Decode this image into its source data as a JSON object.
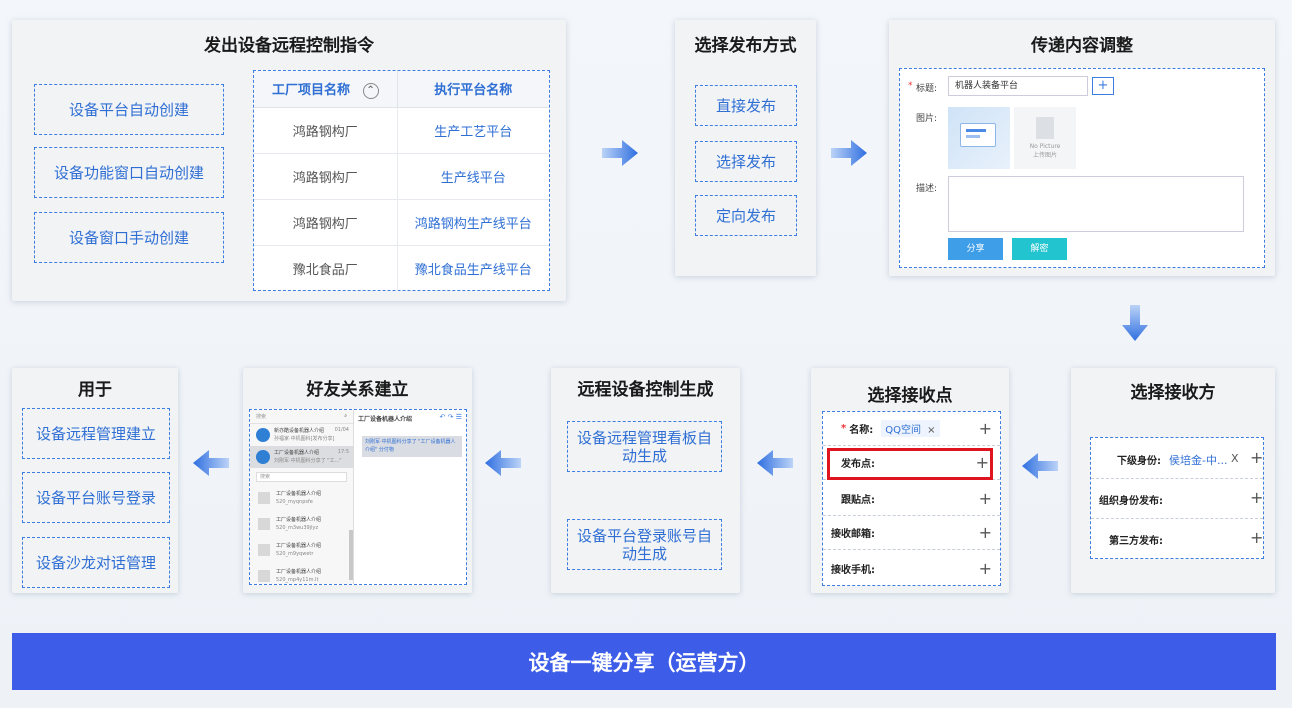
{
  "panel1": {
    "title": "发出设备远程控制指令",
    "options": [
      "设备平台自动创建",
      "设备功能窗口自动创建",
      "设备窗口手动创建"
    ],
    "table": {
      "headers": [
        "工厂项目名称",
        "执行平台名称"
      ],
      "rows": [
        [
          "鸿路钢构厂",
          "生产工艺平台"
        ],
        [
          "鸿路钢构厂",
          "生产线平台"
        ],
        [
          "鸿路钢构厂",
          "鸿路钢构生产线平台"
        ],
        [
          "豫北食品厂",
          "豫北食品生产线平台"
        ]
      ]
    }
  },
  "panel2": {
    "title": "选择发布方式",
    "options": [
      "直接发布",
      "选择发布",
      "定向发布"
    ]
  },
  "panel3": {
    "title": "传递内容调整",
    "form": {
      "title_label": "标题:",
      "title_value": "机器人装备平台",
      "image_label": "图片:",
      "no_picture": "No Picture",
      "upload_label": "上传图片",
      "desc_label": "描述:",
      "share_button": "分享",
      "decrypt_button": "解密"
    }
  },
  "panel4": {
    "title": "选择接收方",
    "rows": [
      {
        "label": "下级身份:",
        "value": "侯培金-中...",
        "remove": "X"
      },
      {
        "label": "组织身份发布:",
        "value": ""
      },
      {
        "label": "第三方发布:",
        "value": ""
      }
    ]
  },
  "panel5": {
    "title": "选择接收点",
    "rows": [
      {
        "label": "名称:",
        "required": "*",
        "tag": "QQ空间",
        "remove": "×"
      },
      {
        "label": "发布点:"
      },
      {
        "label": "跟贴点:"
      },
      {
        "label": "接收邮箱:"
      },
      {
        "label": "接收手机:"
      }
    ]
  },
  "panel6": {
    "title": "远程设备控制生成",
    "options": [
      "设备远程管理看板自动生成",
      "设备平台登录账号自动生成"
    ]
  },
  "panel7": {
    "title": "好友关系建立",
    "chat": {
      "search_placeholder": "搜索",
      "header_title": "工厂设备机器人介绍",
      "contacts_top": [
        {
          "name": "新亦酷设备机器人介绍",
          "time": "01/04",
          "msg": "孙福家·中机图科[发布分享]"
        },
        {
          "name": "工厂设备机器人介绍",
          "time": "17:5",
          "msg": "刘刚军·中机图科分享了 \"工...\""
        }
      ],
      "search2": "搜索",
      "contacts": [
        {
          "name": "工厂设备机器人介绍",
          "sub": "520_myqnpsfe"
        },
        {
          "name": "工厂设备机器人介绍",
          "sub": "520_m3wu39jlyz"
        },
        {
          "name": "工厂设备机器人介绍",
          "sub": "520_m9yqwetr"
        },
        {
          "name": "工厂设备机器人介绍",
          "sub": "520_mp4y11m.lt"
        }
      ],
      "message": "刘刚军·中机图科分享了 \"工厂设备机器人介绍\" 分付物"
    }
  },
  "panel8": {
    "title": "用于",
    "options": [
      "设备远程管理建立",
      "设备平台账号登录",
      "设备沙龙对话管理"
    ]
  },
  "banner": "设备一键分享（运营方）",
  "colors": {
    "accent": "#3d5de8",
    "dashed": "#3d7de0",
    "highlight": "#e0141e"
  }
}
